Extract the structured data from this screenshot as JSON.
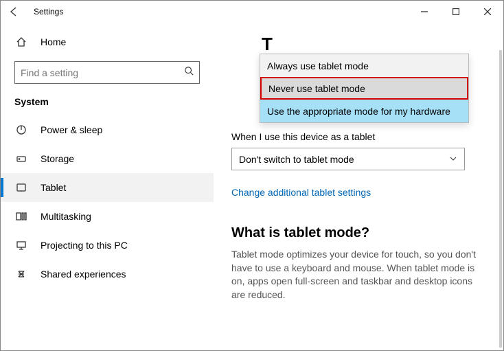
{
  "window": {
    "title": "Settings"
  },
  "sidebar": {
    "home_label": "Home",
    "search_placeholder": "Find a setting",
    "section_label": "System",
    "items": [
      {
        "label": "Power & sleep"
      },
      {
        "label": "Storage"
      },
      {
        "label": "Tablet"
      },
      {
        "label": "Multitasking"
      },
      {
        "label": "Projecting to this PC"
      },
      {
        "label": "Shared experiences"
      }
    ]
  },
  "content": {
    "page_title_partial": "T",
    "dropdown1": {
      "options": [
        "Always use tablet mode",
        "Never use tablet mode",
        "Use the appropriate mode for my hardware"
      ]
    },
    "field2_label": "When I use this device as a tablet",
    "field2_value": "Don't switch to tablet mode",
    "link_text": "Change additional tablet settings",
    "heading2": "What is tablet mode?",
    "description": "Tablet mode optimizes your device for touch, so you don't have to use a keyboard and mouse. When tablet mode is on, apps open full-screen and taskbar and desktop icons are reduced."
  }
}
